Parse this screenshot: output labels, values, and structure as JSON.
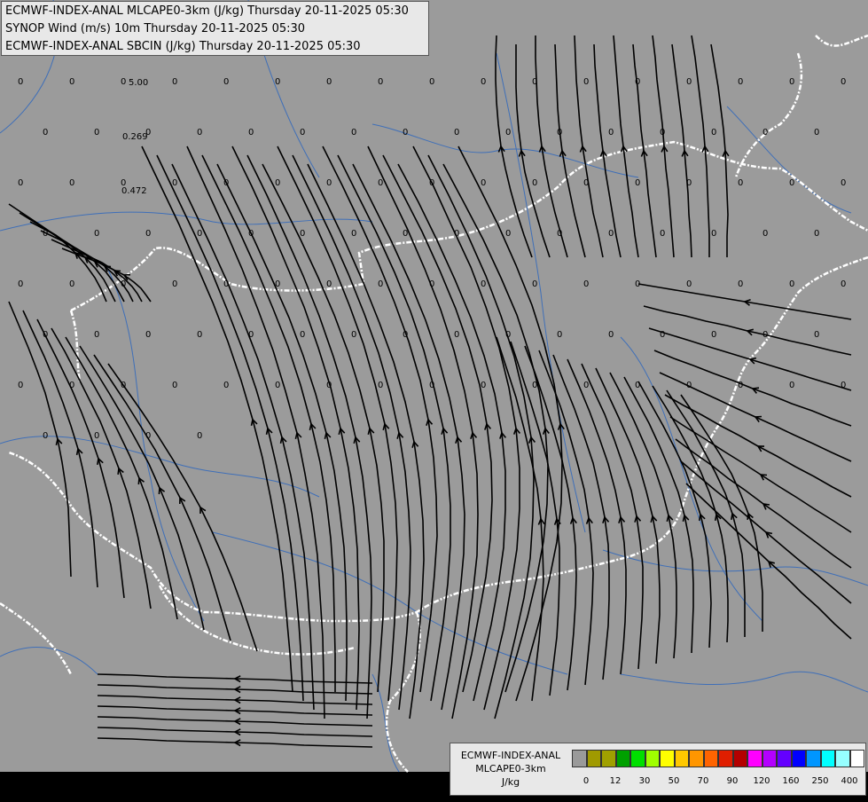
{
  "titles": {
    "line1": "ECMWF-INDEX-ANAL MLCAPE0-3km (J/kg) Thursday 20-11-2025 05:30",
    "line2": "SYNOP Wind (m/s) 10m Thursday 20-11-2025 05:30",
    "line3": "ECMWF-INDEX-ANAL SBCIN (J/kg) Thursday 20-11-2025 05:30"
  },
  "legend": {
    "line1": "ECMWF-INDEX-ANAL",
    "line2": "MLCAPE0-3km",
    "line3": "J/kg",
    "colors": [
      "#9a9a9a",
      "#a09a00",
      "#a0a000",
      "#00a000",
      "#00e000",
      "#a0ff00",
      "#ffff00",
      "#ffc800",
      "#ff9600",
      "#ff6400",
      "#e01e00",
      "#b40000",
      "#ff00ff",
      "#b400ff",
      "#6400ff",
      "#0000ff",
      "#0096ff",
      "#00ffff",
      "#96ffff",
      "#ffffff"
    ],
    "tick_labels": [
      "0",
      "12",
      "30",
      "50",
      "70",
      "90",
      "120",
      "160",
      "250",
      "400"
    ]
  },
  "map": {
    "background_color": "#9b9b9b",
    "border_color": "#ffffff",
    "river_color": "#3f6fb8",
    "streamline_color": "#000000",
    "cape_values": [
      "0",
      "0",
      "0",
      "0",
      "0",
      "0",
      "0",
      "0",
      "0",
      "0",
      "0",
      "0",
      "0",
      "0",
      "0",
      "0",
      "0",
      "0",
      "0",
      "0",
      "0",
      "0",
      "0",
      "0",
      "0",
      "0",
      "0",
      "0",
      "0",
      "0",
      "0",
      "0",
      "0",
      "0",
      "0",
      "0",
      "0",
      "0",
      "0",
      "0",
      "0",
      "0",
      "0",
      "0",
      "0",
      "0",
      "0",
      "0",
      "0",
      "0",
      "0",
      "0",
      "0",
      "0",
      "0",
      "0",
      "0",
      "0",
      "0",
      "0",
      "0",
      "0",
      "0",
      "0",
      "0",
      "0",
      "0",
      "0",
      "0",
      "0",
      "0",
      "0",
      "0",
      "0",
      "0",
      "0",
      "0",
      "0",
      "0",
      "0",
      "0",
      "0",
      "0",
      "0",
      "0",
      "0",
      "0",
      "0",
      "0",
      "0",
      "0",
      "0",
      "0",
      "0",
      "0",
      "0",
      "0",
      "0",
      "0",
      "0",
      "0",
      "0",
      "0",
      "0",
      "0",
      "0",
      "0",
      "0",
      "0",
      "0",
      "0",
      "0",
      "0",
      "0",
      "0",
      "0",
      "0",
      "0",
      "0",
      "0"
    ],
    "cin_labels": [
      "5.00",
      "0.269",
      "0.472"
    ]
  }
}
